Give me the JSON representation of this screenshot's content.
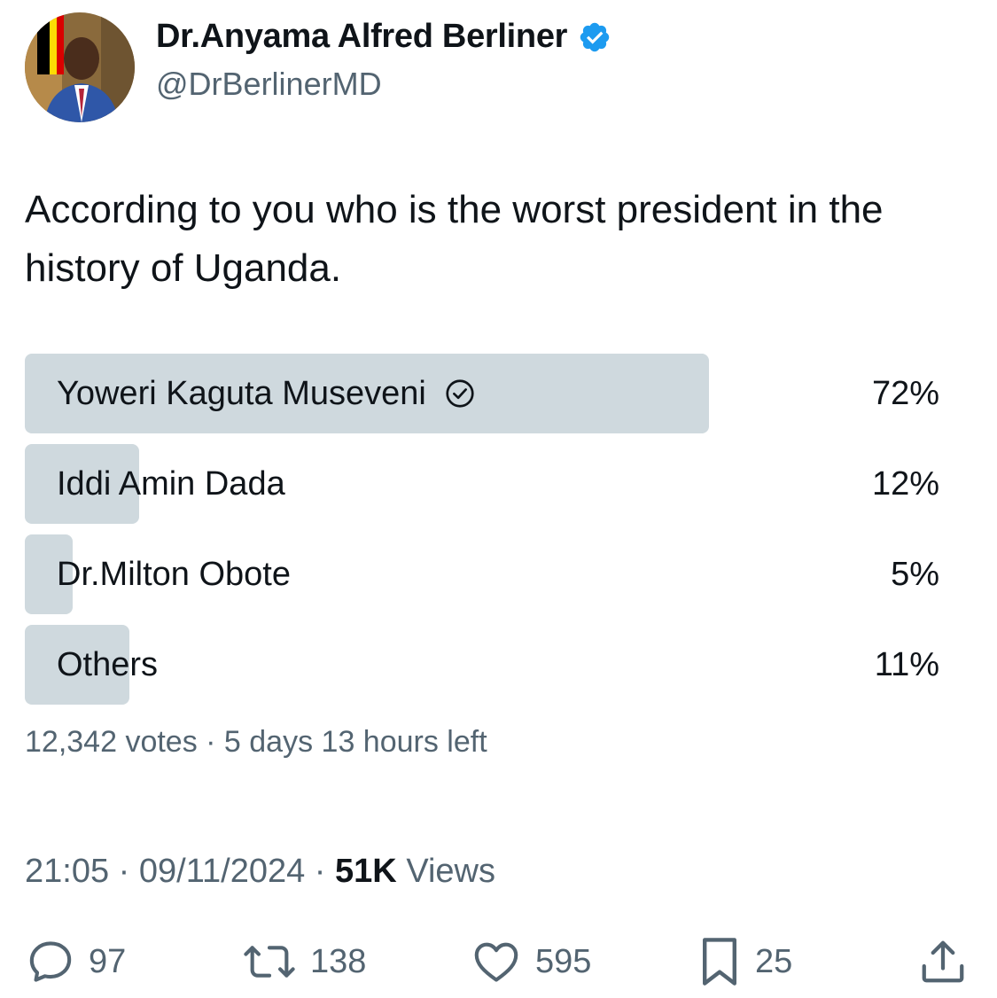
{
  "author": {
    "name": "Dr.Anyama Alfred Berliner",
    "handle": "@DrBerlinerMD",
    "verified": true
  },
  "tweet": {
    "text": "According to you who is the worst president in the history of Uganda."
  },
  "poll": {
    "options": [
      {
        "label": "Yoweri Kaguta Museveni",
        "percent_label": "72%",
        "percent": 72,
        "selected": true
      },
      {
        "label": "Iddi Amin Dada",
        "percent_label": "12%",
        "percent": 12,
        "selected": false
      },
      {
        "label": "Dr.Milton Obote",
        "percent_label": "5%",
        "percent": 5,
        "selected": false
      },
      {
        "label": "Others",
        "percent_label": "11%",
        "percent": 11,
        "selected": false
      }
    ],
    "meta": "12,342 votes · 5 days 13 hours left"
  },
  "timestamp": {
    "time": "21:05",
    "date": "09/11/2024",
    "views_count": "51K",
    "views_label": "Views"
  },
  "actions": {
    "replies": "97",
    "retweets": "138",
    "likes": "595",
    "bookmarks": "25"
  },
  "colors": {
    "verified": "#1d9bf0",
    "poll_bar": "#cfd9de",
    "secondary_text": "#536471"
  },
  "icons": [
    "reply-icon",
    "retweet-icon",
    "like-icon",
    "bookmark-icon",
    "share-icon",
    "verified-badge-icon",
    "selected-check-icon"
  ]
}
